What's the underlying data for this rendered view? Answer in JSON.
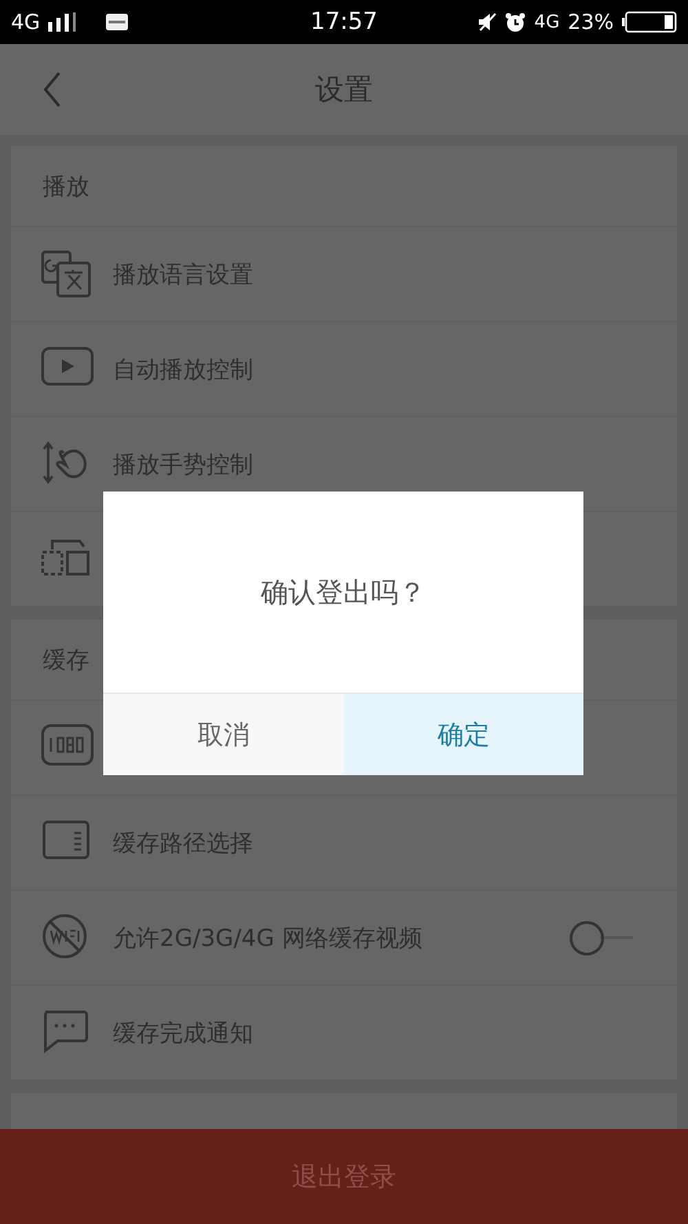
{
  "status_bar": {
    "network": "4G",
    "time": "17:57",
    "network_right": "4G",
    "battery": "23%"
  },
  "header": {
    "title": "设置"
  },
  "sections": [
    {
      "title": "播放",
      "items": [
        {
          "kind": "language",
          "label": "播放语言设置"
        },
        {
          "kind": "play",
          "label": "自动播放控制"
        },
        {
          "kind": "gesture",
          "label": "播放手势控制"
        },
        {
          "kind": "switch-screen"
        }
      ]
    },
    {
      "title": "缓存",
      "items": [
        {
          "kind": "resolution"
        },
        {
          "kind": "storage",
          "label": "缓存路径选择"
        },
        {
          "kind": "no-wifi",
          "label": "允许2G/3G/4G 网络缓存视频",
          "toggle": {
            "on": false
          }
        },
        {
          "kind": "message",
          "label": "缓存完成通知"
        }
      ]
    }
  ],
  "logout_button": "退出登录",
  "dialog": {
    "message": "确认登出吗？",
    "buttons": [
      {
        "label": "取消",
        "kind": "cancel"
      },
      {
        "label": "确定",
        "kind": "confirm"
      }
    ]
  }
}
